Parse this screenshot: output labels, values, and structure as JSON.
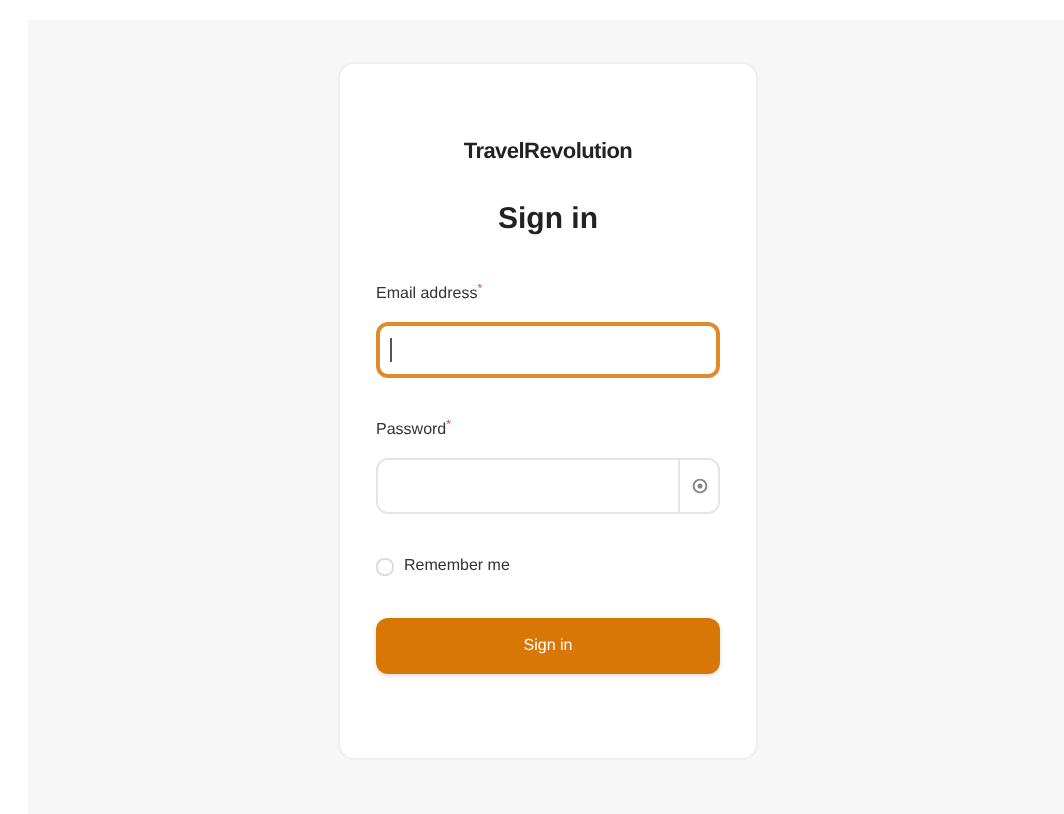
{
  "brand": "TravelRevolution",
  "heading": "Sign in",
  "fields": [
    {
      "label": "Email address",
      "required_mark": "*",
      "focused": true,
      "kind": "text"
    },
    {
      "label": "Password",
      "required_mark": "*",
      "focused": false,
      "kind": "password"
    }
  ],
  "remember": {
    "label": "Remember me",
    "checked": false
  },
  "submit": {
    "label": "Sign in"
  }
}
